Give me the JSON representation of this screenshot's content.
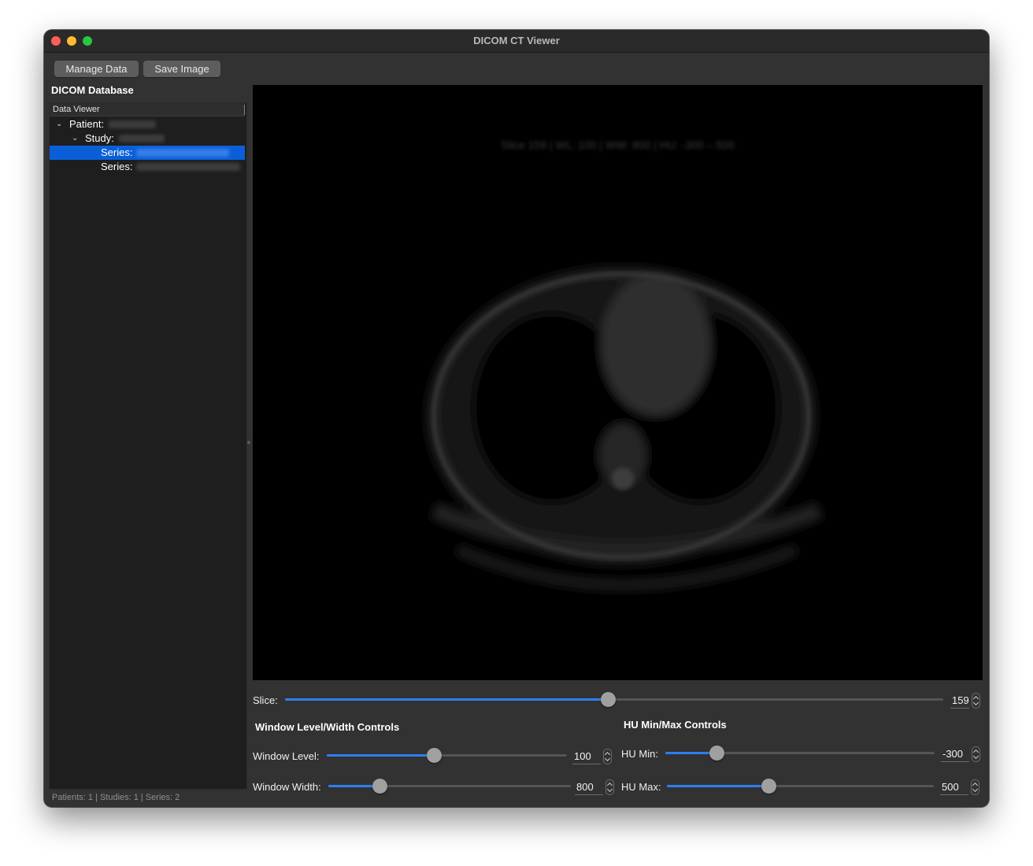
{
  "window": {
    "title": "DICOM CT Viewer"
  },
  "toolbar": {
    "manage_label": "Manage Data",
    "save_label": "Save Image"
  },
  "sidebar": {
    "title": "DICOM Database",
    "tree_header": "Data Viewer",
    "rows": [
      {
        "label": "Patient:"
      },
      {
        "label": "Study:"
      },
      {
        "label": "Series:"
      },
      {
        "label": "Series:"
      }
    ],
    "status": "Patients: 1 | Studies: 1 | Series: 2"
  },
  "viewer": {
    "overlay_text": "Slice 159 | WL: 100 | WW: 800 | HU: -300 – 500"
  },
  "slice": {
    "label": "Slice:",
    "value": "159",
    "fraction": 0.49
  },
  "wl_section": {
    "title": "Window Level/Width Controls"
  },
  "hu_section": {
    "title": "HU Min/Max Controls"
  },
  "window_level": {
    "label": "Window Level:",
    "value": "100",
    "fraction": 0.446
  },
  "window_width": {
    "label": "Window Width:",
    "value": "800",
    "fraction": 0.21
  },
  "hu_min": {
    "label": "HU Min:",
    "value": "-300",
    "fraction": 0.19
  },
  "hu_max": {
    "label": "HU Max:",
    "value": "500",
    "fraction": 0.38
  },
  "colors": {
    "accent": "#2d7ff0",
    "selection": "#0a5fd8",
    "window_bg": "#323232"
  }
}
